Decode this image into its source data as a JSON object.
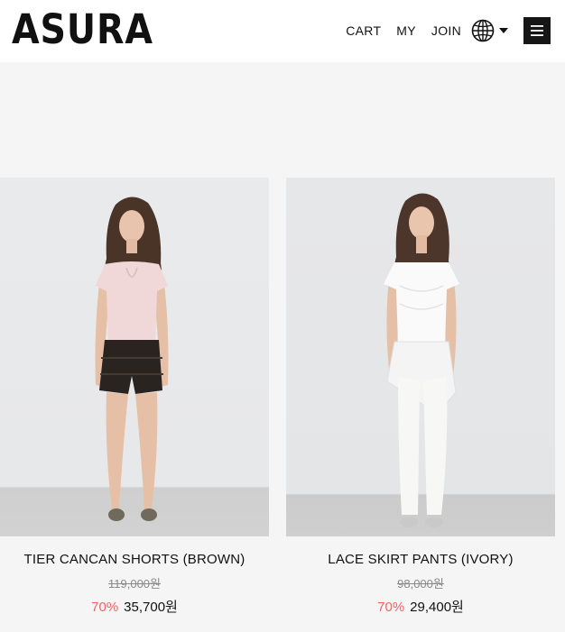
{
  "header": {
    "logo": "ASURA",
    "nav": {
      "cart": "CART",
      "my": "MY",
      "join": "JOIN"
    },
    "icons": {
      "language": "globe-icon",
      "dropdown": "caret-down-icon",
      "menu": "hamburger-menu-icon"
    }
  },
  "products": [
    {
      "name": "TIER CANCAN SHORTS (BROWN)",
      "original_price": "119,000원",
      "discount": "70%",
      "price": "35,700원"
    },
    {
      "name": "LACE SKIRT PANTS (IVORY)",
      "original_price": "98,000원",
      "discount": "70%",
      "price": "29,400원"
    }
  ],
  "colors": {
    "discount": "#f06463",
    "background": "#f5f5f5",
    "header": "#ffffff",
    "menu_button": "#161616"
  }
}
